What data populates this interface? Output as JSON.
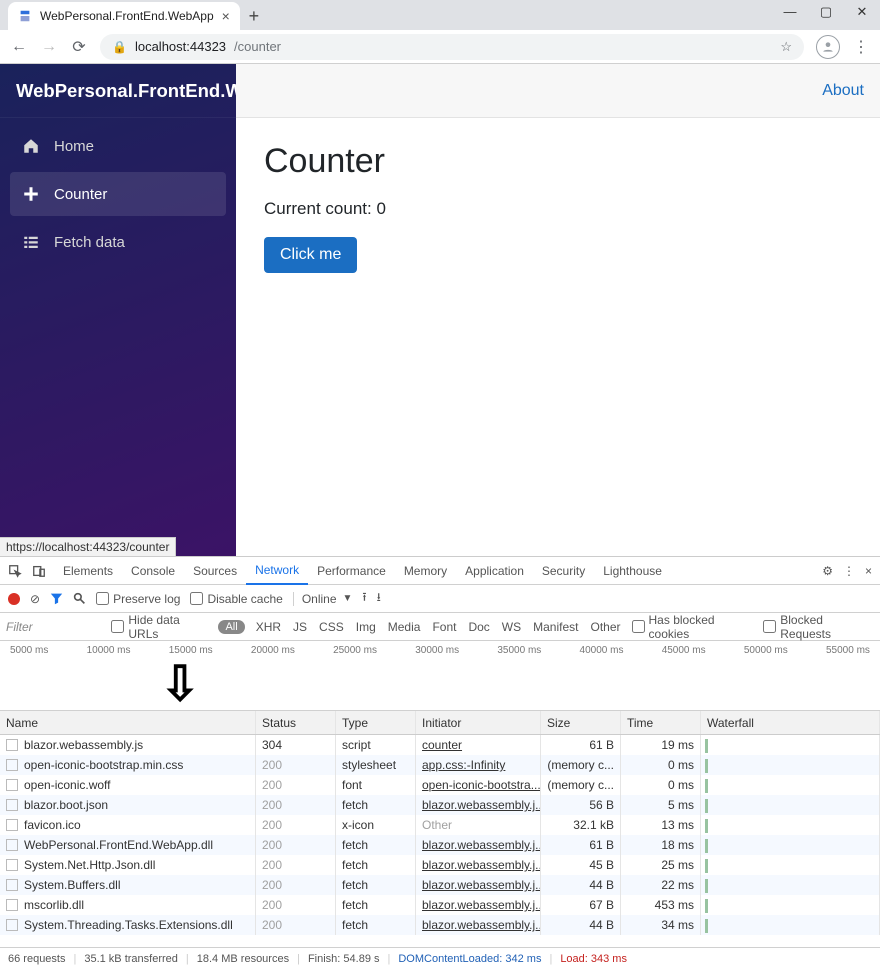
{
  "browser": {
    "tab_title": "WebPersonal.FrontEnd.WebApp",
    "url_host": "localhost:44323",
    "url_path": "/counter",
    "hover_url": "https://localhost:44323/counter"
  },
  "app": {
    "brand": "WebPersonal.FrontEnd.WebApp",
    "topbar_about": "About",
    "page_title": "Counter",
    "count_label": "Current count:",
    "count_value": "0",
    "button_label": "Click me",
    "nav": [
      {
        "label": "Home",
        "icon": "home",
        "active": false
      },
      {
        "label": "Counter",
        "icon": "plus",
        "active": true
      },
      {
        "label": "Fetch data",
        "icon": "list",
        "active": false
      }
    ]
  },
  "devtools": {
    "tabs": [
      "Elements",
      "Console",
      "Sources",
      "Network",
      "Performance",
      "Memory",
      "Application",
      "Security",
      "Lighthouse"
    ],
    "active_tab": "Network",
    "preserve_log": "Preserve log",
    "disable_cache": "Disable cache",
    "online": "Online",
    "filter_placeholder": "Filter",
    "hide_data_urls": "Hide data URLs",
    "all_pill": "All",
    "filter_types": [
      "XHR",
      "JS",
      "CSS",
      "Img",
      "Media",
      "Font",
      "Doc",
      "WS",
      "Manifest",
      "Other"
    ],
    "blocked_cookies": "Has blocked cookies",
    "blocked_requests": "Blocked Requests",
    "ticks": [
      "5000 ms",
      "10000 ms",
      "15000 ms",
      "20000 ms",
      "25000 ms",
      "30000 ms",
      "35000 ms",
      "40000 ms",
      "45000 ms",
      "50000 ms",
      "55000 ms"
    ],
    "columns": [
      "Name",
      "Status",
      "Type",
      "Initiator",
      "Size",
      "Time",
      "Waterfall"
    ],
    "rows": [
      {
        "name": "blazor.webassembly.js",
        "status": "304",
        "status_dim": false,
        "type": "script",
        "initiator": "counter",
        "init_dim": false,
        "size": "61 B",
        "time": "19 ms"
      },
      {
        "name": "open-iconic-bootstrap.min.css",
        "status": "200",
        "status_dim": true,
        "type": "stylesheet",
        "initiator": "app.css:-Infinity",
        "init_dim": false,
        "size": "(memory c...",
        "time": "0 ms"
      },
      {
        "name": "open-iconic.woff",
        "status": "200",
        "status_dim": true,
        "type": "font",
        "initiator": "open-iconic-bootstra...",
        "init_dim": false,
        "size": "(memory c...",
        "time": "0 ms"
      },
      {
        "name": "blazor.boot.json",
        "status": "200",
        "status_dim": true,
        "type": "fetch",
        "initiator": "blazor.webassembly.j...",
        "init_dim": false,
        "size": "56 B",
        "time": "5 ms"
      },
      {
        "name": "favicon.ico",
        "status": "200",
        "status_dim": true,
        "type": "x-icon",
        "initiator": "Other",
        "init_dim": true,
        "size": "32.1 kB",
        "time": "13 ms"
      },
      {
        "name": "WebPersonal.FrontEnd.WebApp.dll",
        "status": "200",
        "status_dim": true,
        "type": "fetch",
        "initiator": "blazor.webassembly.j...",
        "init_dim": false,
        "size": "61 B",
        "time": "18 ms"
      },
      {
        "name": "System.Net.Http.Json.dll",
        "status": "200",
        "status_dim": true,
        "type": "fetch",
        "initiator": "blazor.webassembly.j...",
        "init_dim": false,
        "size": "45 B",
        "time": "25 ms"
      },
      {
        "name": "System.Buffers.dll",
        "status": "200",
        "status_dim": true,
        "type": "fetch",
        "initiator": "blazor.webassembly.j...",
        "init_dim": false,
        "size": "44 B",
        "time": "22 ms"
      },
      {
        "name": "mscorlib.dll",
        "status": "200",
        "status_dim": true,
        "type": "fetch",
        "initiator": "blazor.webassembly.j...",
        "init_dim": false,
        "size": "67 B",
        "time": "453 ms"
      },
      {
        "name": "System.Threading.Tasks.Extensions.dll",
        "status": "200",
        "status_dim": true,
        "type": "fetch",
        "initiator": "blazor.webassembly.j...",
        "init_dim": false,
        "size": "44 B",
        "time": "34 ms"
      }
    ],
    "status_bar": {
      "requests": "66 requests",
      "transferred": "35.1 kB transferred",
      "resources": "18.4 MB resources",
      "finish": "Finish: 54.89 s",
      "dcl": "DOMContentLoaded: 342 ms",
      "load": "Load: 343 ms"
    }
  }
}
